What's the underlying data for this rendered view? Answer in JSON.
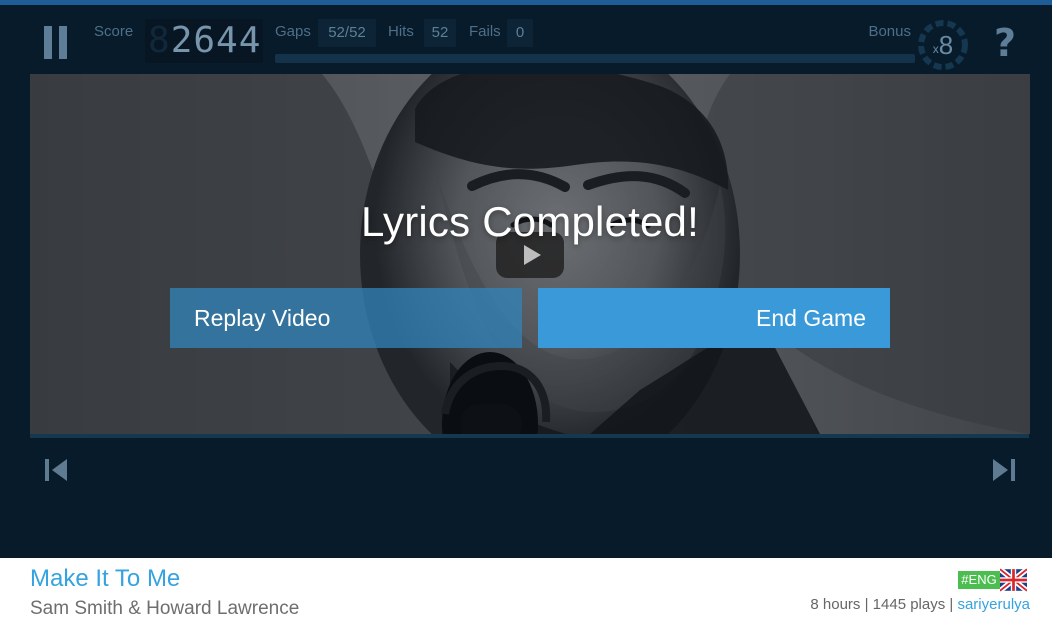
{
  "hud": {
    "score_label": "Score",
    "score_display": "2644",
    "score_ghost": "8",
    "gaps_label": "Gaps",
    "gaps_value": "52/52",
    "hits_label": "Hits",
    "hits_value": "52",
    "fails_label": "Fails",
    "fails_value": "0",
    "bonus_label": "Bonus",
    "bonus_prefix": "x",
    "bonus_value": "8",
    "help_label": "?",
    "progress_fraction": 1.0,
    "pause_icon": "pause-icon",
    "help_icon": "question-mark-icon"
  },
  "video": {
    "completion_title": "Lyrics Completed!",
    "play_icon": "play-icon",
    "replay_button": "Replay Video",
    "end_game_button": "End Game"
  },
  "navigation": {
    "previous_icon": "skip-previous-icon",
    "next_icon": "skip-next-icon"
  },
  "song": {
    "title": "Make It To Me",
    "artist": "Sam Smith & Howard Lawrence",
    "language_tag": "#ENG",
    "flag_icon": "uk-flag-icon",
    "duration": "8 hours",
    "plays": "1445 plays",
    "separator": " | ",
    "uploader": "sariyerulya"
  },
  "colors": {
    "top_accent": "#1f5d96",
    "game_background": "#071b2b",
    "replay_button": "#3083b9",
    "end_button": "#3a9ad9",
    "song_link": "#35a3df",
    "language_badge": "#4cbd4f"
  }
}
